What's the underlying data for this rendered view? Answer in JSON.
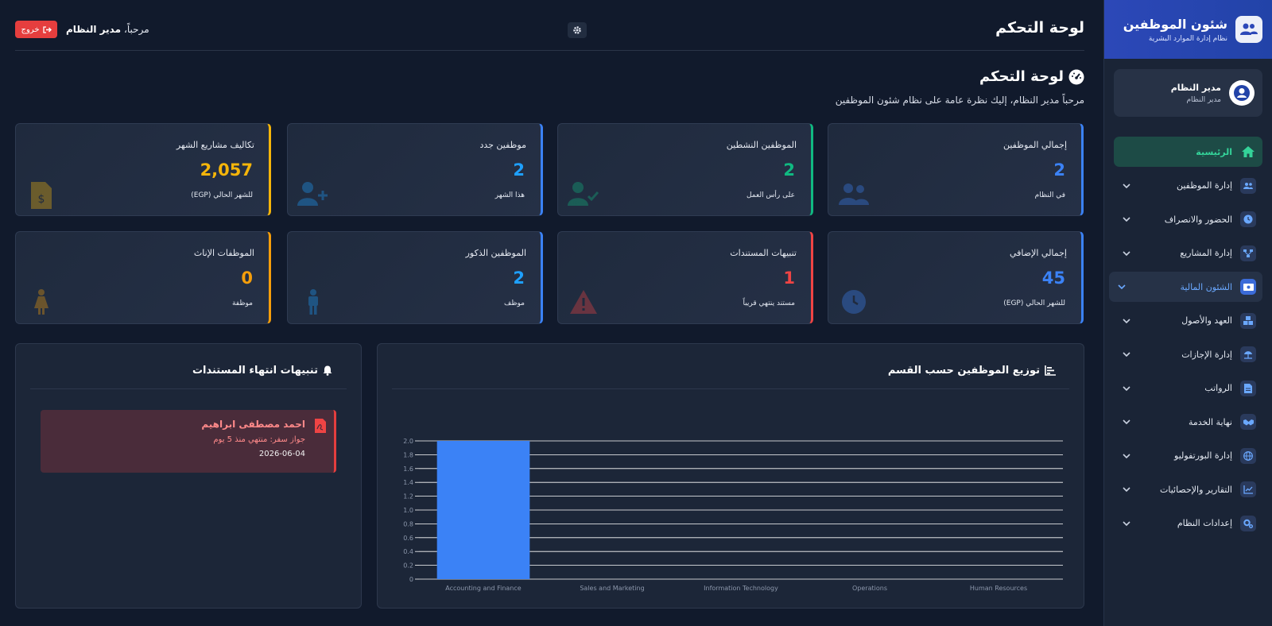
{
  "header": {
    "title": "لوحة التحكم",
    "welcome_prefix": "مرحباً،",
    "welcome_name": "مدير النظام",
    "logout_label": "خروج"
  },
  "page": {
    "title": "لوحة التحكم",
    "subtitle": "مرحباً مدير النظام، إليك نظرة عامة على نظام شئون الموظفين"
  },
  "sidebar": {
    "brand_title": "شئون الموظفين",
    "brand_sub": "نظام إدارة الموارد البشرية",
    "user_name": "مدير النظام",
    "user_role": "مدير النظام",
    "items": [
      {
        "label": "الرئيسية"
      },
      {
        "label": "إدارة الموظفين"
      },
      {
        "label": "الحضور والانصراف"
      },
      {
        "label": "إدارة المشاريع"
      },
      {
        "label": "الشئون المالية"
      },
      {
        "label": "العهد والأصول"
      },
      {
        "label": "إدارة الإجازات"
      },
      {
        "label": "الرواتب"
      },
      {
        "label": "نهاية الخدمة"
      },
      {
        "label": "إدارة البورتفوليو"
      },
      {
        "label": "التقارير والإحصائيات"
      },
      {
        "label": "إعدادات النظام"
      }
    ]
  },
  "cards": [
    {
      "title": "إجمالي الموظفين",
      "value": "2",
      "sub": "في النظام",
      "color": "#3b82f6",
      "icon": "users-icon"
    },
    {
      "title": "الموظفين النشطين",
      "value": "2",
      "sub": "على رأس العمل",
      "color": "#10b981",
      "icon": "user-check-icon"
    },
    {
      "title": "موظفين جدد",
      "value": "2",
      "sub": "هذا الشهر",
      "color": "#1ea0ff",
      "icon": "user-plus-icon"
    },
    {
      "title": "تكاليف مشاريع الشهر",
      "value": "2,057",
      "sub": "للشهر الحالي (EGP)",
      "color": "#f5b50a",
      "icon": "invoice-dollar-icon"
    },
    {
      "title": "إجمالي الإضافي",
      "value": "45",
      "sub": "للشهر الحالي (EGP)",
      "color": "#3b82f6",
      "icon": "clock-icon"
    },
    {
      "title": "تنبيهات المستندات",
      "value": "1",
      "sub": "مستند ينتهي قريباً",
      "color": "#ef4444",
      "icon": "warning-icon"
    },
    {
      "title": "الموظفين الذكور",
      "value": "2",
      "sub": "موظف",
      "color": "#1ea0ff",
      "icon": "male-icon"
    },
    {
      "title": "الموظفات الإناث",
      "value": "0",
      "sub": "موظفة",
      "color": "#f59e0b",
      "icon": "female-icon"
    }
  ],
  "alerts_panel": {
    "title": "تنبيهات انتهاء المستندات",
    "alerts": [
      {
        "name": "احمد مصطفى ابراهيم",
        "doc": "جواز سفر: منتهي منذ 5 يوم",
        "date": "2026-06-04"
      }
    ]
  },
  "chart_panel": {
    "title": "توزيع الموظفين حسب القسم"
  },
  "chart_data": {
    "type": "bar",
    "categories": [
      "Accounting and Finance",
      "Sales and Marketing",
      "Information Technology",
      "Operations",
      "Human Resources"
    ],
    "values": [
      2,
      0,
      0,
      0,
      0
    ],
    "ylim": [
      0,
      2
    ],
    "yticks": [
      "0",
      "0.2",
      "0.4",
      "0.6",
      "0.8",
      "1.0",
      "1.2",
      "1.4",
      "1.6",
      "1.8",
      "2.0"
    ],
    "grid": true,
    "bar_color": "#3b82f6"
  }
}
